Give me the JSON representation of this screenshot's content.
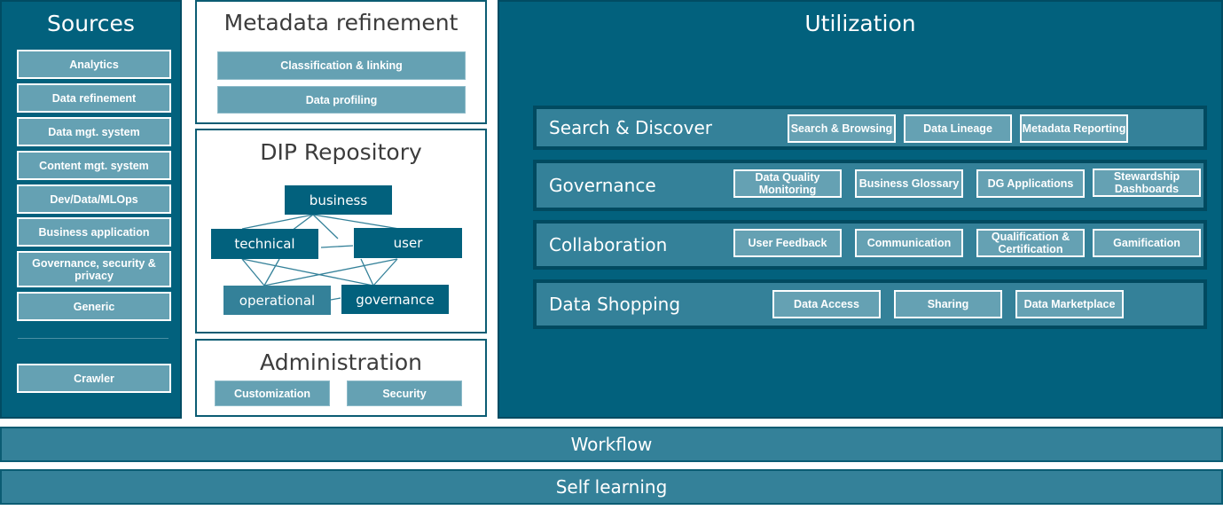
{
  "colors": {
    "dark_teal": "#02617d",
    "mid_teal": "#348199",
    "light_teal": "#65a1b3",
    "border_dark": "#014c63",
    "white": "#ffffff",
    "title_gray": "#3c3c3c"
  },
  "sources": {
    "title": "Sources",
    "items": [
      {
        "label": "Analytics"
      },
      {
        "label": "Data refinement"
      },
      {
        "label": "Data mgt. system"
      },
      {
        "label": "Content mgt. system"
      },
      {
        "label": "Dev/Data/MLOps"
      },
      {
        "label": "Business application"
      },
      {
        "label": "Governance, security & privacy"
      },
      {
        "label": "Generic"
      }
    ],
    "crawler": "Crawler"
  },
  "metadata_refinement": {
    "title": "Metadata refinement",
    "items": [
      {
        "label": "Classification & linking"
      },
      {
        "label": "Data profiling"
      }
    ]
  },
  "dip_repository": {
    "title": "DIP Repository",
    "nodes": {
      "business": "business",
      "technical": "technical",
      "user": "user",
      "operational": "operational",
      "governance": "governance"
    }
  },
  "administration": {
    "title": "Administration",
    "items": [
      {
        "label": "Customization"
      },
      {
        "label": "Security"
      }
    ]
  },
  "utilization": {
    "title": "Utilization",
    "rows": [
      {
        "label": "Search & Discover",
        "items": [
          "Search & Browsing",
          "Data Lineage",
          "Metadata Reporting"
        ]
      },
      {
        "label": "Governance",
        "items": [
          "Data Quality Monitoring",
          "Business Glossary",
          "DG Applications",
          "Stewardship Dashboards"
        ]
      },
      {
        "label": "Collaboration",
        "items": [
          "User Feedback",
          "Communication",
          "Qualification & Certification",
          "Gamification"
        ]
      },
      {
        "label": "Data Shopping",
        "items": [
          "Data Access",
          "Sharing",
          "Data Marketplace"
        ]
      }
    ]
  },
  "bottom": {
    "workflow": "Workflow",
    "self_learning": "Self learning"
  }
}
